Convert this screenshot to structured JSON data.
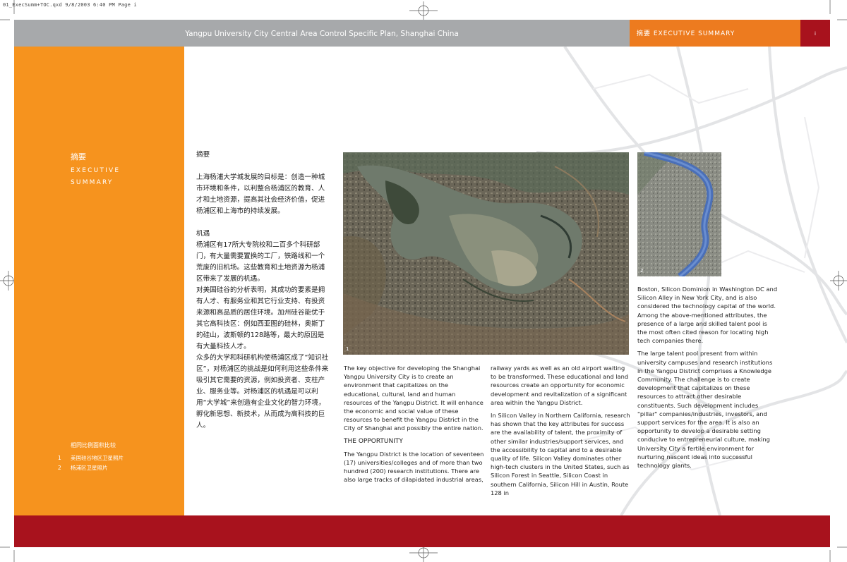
{
  "slug": "01_ExecSumm+TOC.qxd  9/8/2003  6:40 PM  Page i",
  "header": {
    "title": "Yangpu University City Central Area Control Specific Plan, Shanghai China",
    "section": "摘要   EXECUTIVE SUMMARY",
    "page_number": "i"
  },
  "sidebar": {
    "title_cn": "摘要",
    "title_en_1": "EXECUTIVE",
    "title_en_2": "SUMMARY",
    "captions_title": "相同比例面积比较",
    "captions": [
      {
        "num": "1",
        "text": "美国硅谷地区卫星照片"
      },
      {
        "num": "2",
        "text": "杨浦区卫星照片"
      }
    ]
  },
  "chinese": {
    "heading": "摘要",
    "intro": "上海杨浦大学城发展的目标是：创造一种城市环境和条件，以利整合杨浦区的教育、人才和土地资源，提高其社会经济价值，促进杨浦区和上海市的持续发展。",
    "opportunity_heading": "机遇",
    "para1": "杨浦区有17所大专院校和二百多个科研部门，有大量需要置换的工厂，铁路线和一个荒废的旧机场。这些教育和土地资源为杨浦区带来了发展的机遇。",
    "para2": "对美国硅谷的分析表明，其成功的要素是拥有人才、有服务业和其它行业支持、有投资来源和高品质的居住环境。加州硅谷能优于其它高科技区：例如西亚图的硅林，奥斯丁的硅山，波斯顿的128路等，最大的原因是有大量科技人才。",
    "para3": "众多的大学和科研机构使杨浦区成了“知识社区”，对杨浦区的挑战是如何利用这些条件来吸引其它需要的资源，例如投资者、支柱产业、服务业等。对杨浦区的机遇是可以利用“大学城”来创造有企业文化的智力环境，孵化新思想、新技术，从而成为高科技的巨人。"
  },
  "photos": {
    "photo1_label": "1",
    "photo2_label": "2"
  },
  "english": {
    "col1_p1": "The key objective for developing the Shanghai Yangpu University City is to create an environment that capitalizes on the educational, cultural, land and human resources of the Yangpu District. It will enhance the economic and social value of these resources to benefit the Yangpu District in the City of Shanghai and possibly the entire nation.",
    "col1_heading": "THE OPPORTUNITY",
    "col1_p2": "The Yangpu District is the location of seventeen (17) universities/colleges and of more than two hundred (200) research institutions. There are also large tracks of dilapidated industrial areas,",
    "col2_p1": "railway yards as well as an old airport waiting to be transformed. These educational and land resources create an opportunity for economic development and revitalization of a significant area within the Yangpu District.",
    "col2_p2": "In Silicon Valley in Northern California, research has shown that the key attributes for success are the availability of talent, the proximity of other similar industries/support services, and the accessibility to capital and to a desirable quality of life. Silicon Valley dominates other high-tech clusters in the United States, such as Silicon Forest in Seattle, Silicon Coast in southern California, Silicon Hill in Austin, Route 128 in",
    "col3_p1": "Boston, Silicon Dominion in Washington DC and Silicon Alley in New York City, and is also considered the technology capital of the world. Among the above-mentioned attributes, the presence of a large and skilled talent pool is the most often cited reason for locating high tech companies there.",
    "col3_p2": "The large talent pool present from within university campuses and research institutions in the Yangpu District comprises a Knowledge Community. The challenge is to create development that capitalizes on these resources to attract other desirable constituents. Such development includes \"pillar\" companies/industries, investors, and support services for the area. It is also an opportunity to develop a desirable setting conducive to entrepreneurial culture, making University City a fertile environment for nurturing nascent ideas into successful technology giants."
  },
  "colors": {
    "gray_band": "#a7a9ab",
    "orange_band": "#ed7b1f",
    "sidebar_orange": "#f6931e",
    "red_band": "#a8121d"
  }
}
